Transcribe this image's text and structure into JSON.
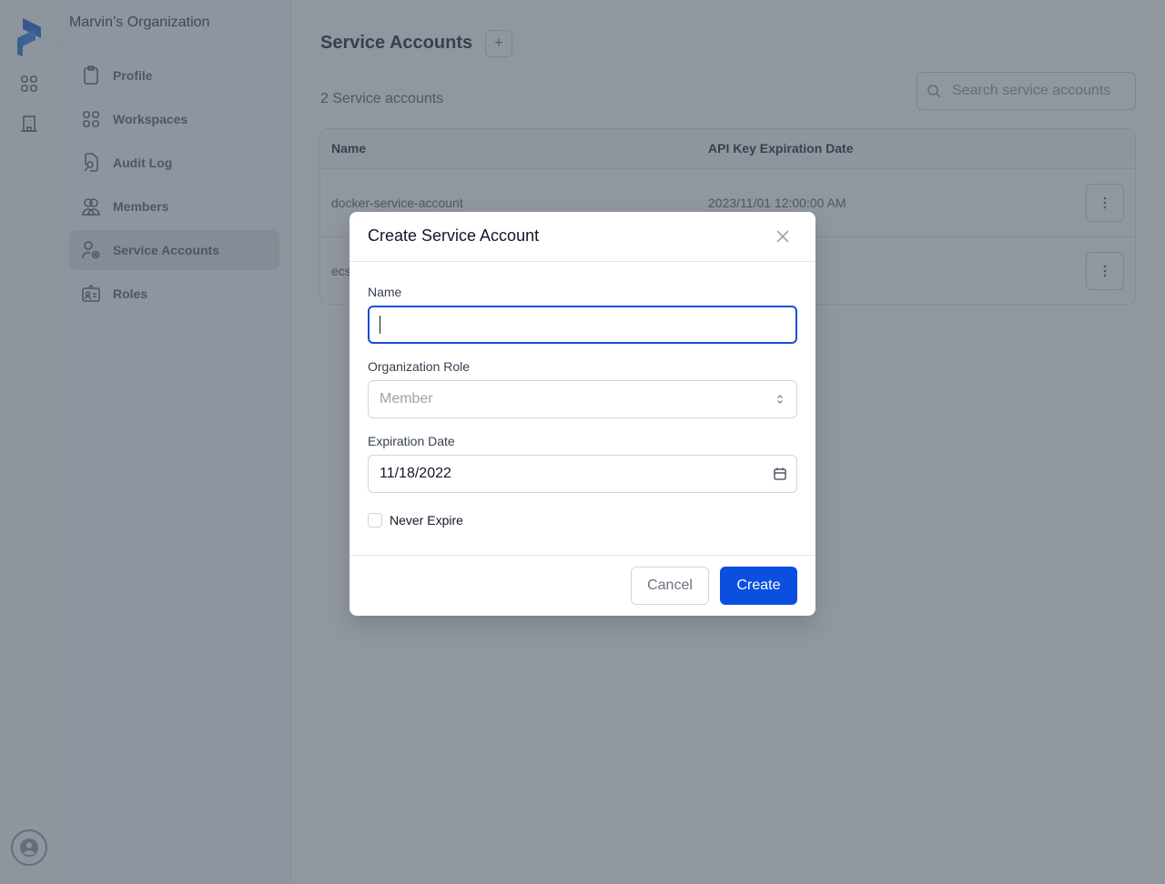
{
  "sidebar": {
    "org_name": "Marvin’s Organization",
    "items": [
      {
        "label": "Profile",
        "icon": "clipboard-icon",
        "active": false
      },
      {
        "label": "Workspaces",
        "icon": "grid-icon",
        "active": false
      },
      {
        "label": "Audit Log",
        "icon": "document-search-icon",
        "active": false
      },
      {
        "label": "Members",
        "icon": "users-icon",
        "active": false
      },
      {
        "label": "Service Accounts",
        "icon": "user-gear-icon",
        "active": true
      },
      {
        "label": "Roles",
        "icon": "id-card-icon",
        "active": false
      }
    ]
  },
  "rail": {
    "icons": [
      "prefect-logo",
      "workspaces-grid-icon",
      "organization-building-icon",
      "user-account-icon"
    ]
  },
  "main": {
    "title": "Service Accounts",
    "add_button": "+",
    "count_text": "2 Service accounts",
    "search_placeholder": "Search service accounts",
    "table": {
      "columns": [
        "Name",
        "API Key Expiration Date"
      ],
      "rows": [
        {
          "name": "docker-service-account",
          "expiration": "2023/11/01 12:00:00 AM"
        },
        {
          "name": "ecs",
          "expiration": ""
        }
      ]
    }
  },
  "modal": {
    "title": "Create Service Account",
    "name_label": "Name",
    "name_value": "",
    "role_label": "Organization Role",
    "role_value": "Member",
    "expiration_label": "Expiration Date",
    "expiration_value": "11/18/2022",
    "never_expire_label": "Never Expire",
    "never_expire_checked": false,
    "cancel_label": "Cancel",
    "create_label": "Create"
  },
  "colors": {
    "accent": "#0a4fe0",
    "focus_ring": "#1d4ed8"
  }
}
